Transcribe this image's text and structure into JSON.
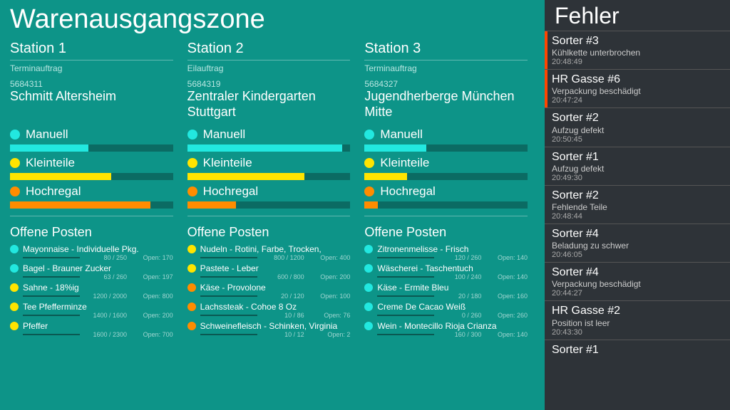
{
  "main_title": "Warenausgangszone",
  "stations": [
    {
      "title": "Station 1",
      "order_type": "Terminauftrag",
      "order_num": "5684311",
      "order_name": "Schmitt Altersheim",
      "cats": [
        {
          "label": "Manuell",
          "color": "c-cyan",
          "pct": 48
        },
        {
          "label": "Kleinteile",
          "color": "c-yellow",
          "pct": 62
        },
        {
          "label": "Hochregal",
          "color": "c-orange",
          "pct": 86
        }
      ],
      "open_title": "Offene Posten",
      "items": [
        {
          "dot": "c-cyan",
          "name": "Mayonnaise - Individuelle Pkg.",
          "count": "80 / 250",
          "open": "Open: 170",
          "pct": 32
        },
        {
          "dot": "c-cyan",
          "name": "Bagel - Brauner Zucker",
          "count": "63 / 260",
          "open": "Open: 197",
          "pct": 24
        },
        {
          "dot": "c-yellow",
          "name": "Sahne - 18%ig",
          "count": "1200 / 2000",
          "open": "Open: 800",
          "pct": 60
        },
        {
          "dot": "c-yellow",
          "name": "Tee Pfefferminze",
          "count": "1400 / 1600",
          "open": "Open: 200",
          "pct": 88
        },
        {
          "dot": "c-yellow",
          "name": "Pfeffer",
          "count": "1600 / 2300",
          "open": "Open: 700",
          "pct": 70
        }
      ]
    },
    {
      "title": "Station 2",
      "order_type": "Eilauftrag",
      "order_num": "5684319",
      "order_name": "Zentraler Kindergarten Stuttgart",
      "cats": [
        {
          "label": "Manuell",
          "color": "c-cyan",
          "pct": 95
        },
        {
          "label": "Kleinteile",
          "color": "c-yellow",
          "pct": 72
        },
        {
          "label": "Hochregal",
          "color": "c-orange",
          "pct": 30
        }
      ],
      "open_title": "Offene Posten",
      "items": [
        {
          "dot": "c-yellow",
          "name": "Nudeln - Rotini, Farbe, Trocken,",
          "count": "800 / 1200",
          "open": "Open: 400",
          "pct": 67
        },
        {
          "dot": "c-yellow",
          "name": "Pastete - Leber",
          "count": "600 / 800",
          "open": "Open: 200",
          "pct": 75
        },
        {
          "dot": "c-orange",
          "name": "Käse - Provolone",
          "count": "20 / 120",
          "open": "Open: 100",
          "pct": 17
        },
        {
          "dot": "c-orange",
          "name": "Lachssteak - Cohoe 8 Oz",
          "count": "10 / 86",
          "open": "Open: 76",
          "pct": 12
        },
        {
          "dot": "c-orange",
          "name": "Schweinefleisch - Schinken, Virginia",
          "count": "10 / 12",
          "open": "Open: 2",
          "pct": 83
        }
      ]
    },
    {
      "title": "Station 3",
      "order_type": "Terminauftrag",
      "order_num": "5684327",
      "order_name": "Jugendherberge München Mitte",
      "cats": [
        {
          "label": "Manuell",
          "color": "c-cyan",
          "pct": 38
        },
        {
          "label": "Kleinteile",
          "color": "c-yellow",
          "pct": 26
        },
        {
          "label": "Hochregal",
          "color": "c-orange",
          "pct": 8
        }
      ],
      "open_title": "Offene Posten",
      "items": [
        {
          "dot": "c-cyan",
          "name": "Zitronenmelisse - Frisch",
          "count": "120 / 260",
          "open": "Open: 140",
          "pct": 46
        },
        {
          "dot": "c-cyan",
          "name": "Wäscherei - Taschentuch",
          "count": "100 / 240",
          "open": "Open: 140",
          "pct": 42
        },
        {
          "dot": "c-cyan",
          "name": "Käse - Ermite Bleu",
          "count": "20 / 180",
          "open": "Open: 160",
          "pct": 11
        },
        {
          "dot": "c-cyan",
          "name": "Creme De Cacao Weiß",
          "count": "0 / 260",
          "open": "Open: 260",
          "pct": 0
        },
        {
          "dot": "c-cyan",
          "name": "Wein - Montecillo Rioja Crianza",
          "count": "160 / 300",
          "open": "Open: 140",
          "pct": 53
        }
      ]
    }
  ],
  "errors_title": "Fehler",
  "errors": [
    {
      "title": "Sorter #3",
      "msg": "Kühlkette unterbrochen",
      "time": "20:48:49",
      "urgent": true
    },
    {
      "title": "HR Gasse #6",
      "msg": "Verpackung beschädigt",
      "time": "20:47:24",
      "urgent": true
    },
    {
      "title": "Sorter #2",
      "msg": "Aufzug defekt",
      "time": "20:50:45",
      "urgent": false
    },
    {
      "title": "Sorter #1",
      "msg": "Aufzug defekt",
      "time": "20:49:30",
      "urgent": false
    },
    {
      "title": "Sorter #2",
      "msg": "Fehlende Teile",
      "time": "20:48:44",
      "urgent": false
    },
    {
      "title": "Sorter #4",
      "msg": "Beladung zu schwer",
      "time": "20:46:05",
      "urgent": false
    },
    {
      "title": "Sorter #4",
      "msg": "Verpackung beschädigt",
      "time": "20:44:27",
      "urgent": false
    },
    {
      "title": "HR Gasse #2",
      "msg": "Position ist leer",
      "time": "20:43:30",
      "urgent": false
    },
    {
      "title": "Sorter #1",
      "msg": "",
      "time": "",
      "urgent": false
    }
  ]
}
